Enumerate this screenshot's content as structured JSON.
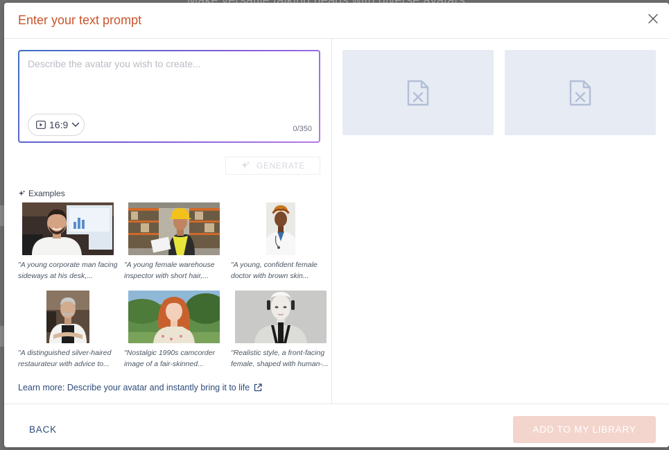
{
  "backdrop": {
    "text": "Make versatile talking heads with diverse avatars"
  },
  "modal": {
    "title": "Enter your text prompt",
    "close_label": "×"
  },
  "prompt": {
    "placeholder": "Describe the avatar you wish to create...",
    "value": "",
    "ratio": "16:9",
    "char_count": "0/350"
  },
  "generate": {
    "label": "GENERATE"
  },
  "examples": {
    "label": "Examples",
    "items": [
      {
        "caption": "\"A young corporate man facing sideways at his desk,..."
      },
      {
        "caption": "\"A young female warehouse inspector with short hair,..."
      },
      {
        "caption": "\"A young, confident female doctor with brown skin..."
      },
      {
        "caption": "\"A distinguished silver-haired restaurateur with advice to..."
      },
      {
        "caption": "\"Nostalgic 1990s camcorder image of a fair-skinned..."
      },
      {
        "caption": "\"Realistic style, a front-facing female, shaped with human-..."
      }
    ]
  },
  "learn_more": {
    "label": "Learn more: Describe your avatar and instantly bring it to life"
  },
  "footer": {
    "back_label": "BACK",
    "add_label": "ADD TO MY LIBRARY"
  },
  "colors": {
    "title": "#c8552c",
    "link": "#2d4b7a",
    "placeholder_slot": "#e6ebf4",
    "add_button": "#f3d5cd"
  }
}
